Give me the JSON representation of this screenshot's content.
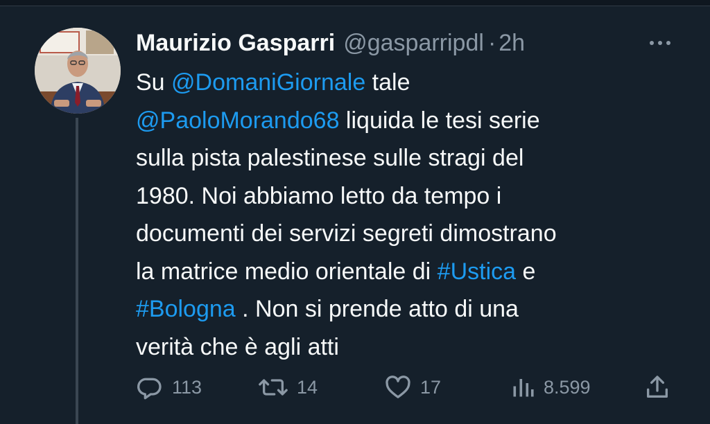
{
  "tweet": {
    "display_name": "Maurizio Gasparri",
    "handle": "@gasparripdl",
    "separator": "·",
    "time": "2h",
    "text_lines": [
      [
        {
          "t": "Su "
        },
        {
          "t": "@DomaniGiornale",
          "link": true
        },
        {
          "t": " tale"
        }
      ],
      [
        {
          "t": "@PaoloMorando68",
          "link": true
        },
        {
          "t": " liquida le tesi serie"
        }
      ],
      [
        {
          "t": "sulla pista palestinese sulle stragi del"
        }
      ],
      [
        {
          "t": "1980. Noi abbiamo letto da tempo i"
        }
      ],
      [
        {
          "t": "documenti dei servizi segreti dimostrano"
        }
      ],
      [
        {
          "t": "la matrice medio orientale di "
        },
        {
          "t": "#Ustica",
          "link": true
        },
        {
          "t": " e"
        }
      ],
      [
        {
          "t": "#Bologna",
          "link": true
        },
        {
          "t": " . Non si prende atto di una"
        }
      ],
      [
        {
          "t": "verità che è agli atti"
        }
      ]
    ]
  },
  "actions": {
    "replies": "113",
    "retweets": "14",
    "likes": "17",
    "views": "8.599"
  },
  "colors": {
    "background": "#15202b",
    "link": "#1d9bf0",
    "muted": "#8b98a5",
    "text": "#f7f9f9"
  },
  "icons": [
    "more-icon",
    "reply-icon",
    "retweet-icon",
    "like-icon",
    "views-icon",
    "share-icon"
  ]
}
